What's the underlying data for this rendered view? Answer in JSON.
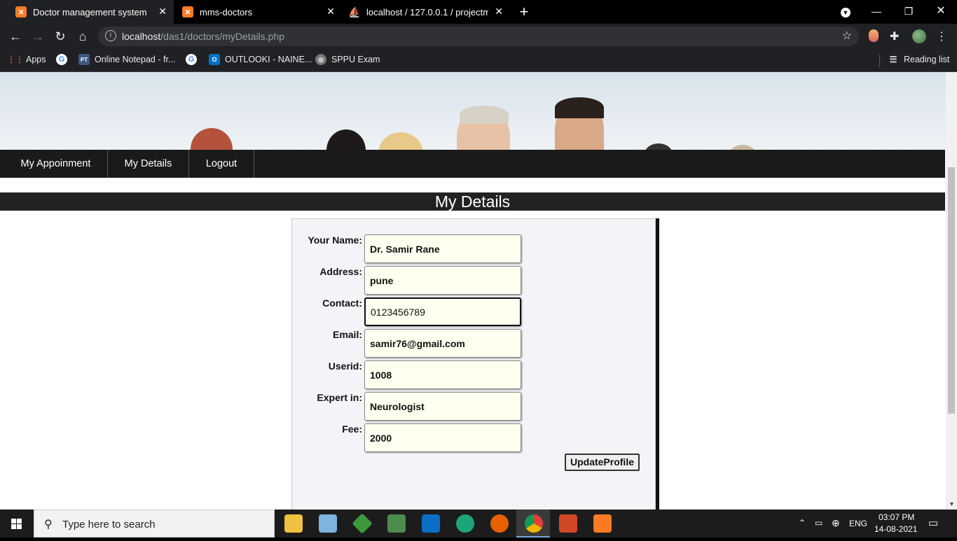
{
  "browser": {
    "tabs": [
      {
        "title": "Doctor management system"
      },
      {
        "title": "mms-doctors"
      },
      {
        "title": "localhost / 127.0.0.1 / projectmm"
      }
    ],
    "url_host": "localhost",
    "url_path": "/das1/doctors/myDetails.php",
    "bookmarks": [
      "Apps",
      "Online Notepad - fr...",
      "OUTLOOKI - NAINE...",
      "SPPU Exam"
    ],
    "reading_list": "Reading list"
  },
  "menu": {
    "items": [
      "My Appoinment",
      "My Details",
      "Logout"
    ]
  },
  "page": {
    "heading": "My Details"
  },
  "form": {
    "fields": [
      {
        "label": "Your Name:",
        "value": "Dr. Samir Rane"
      },
      {
        "label": "Address:",
        "value": "pune"
      },
      {
        "label": "Contact:",
        "value": "0123456789"
      },
      {
        "label": "Email:",
        "value": "samir76@gmail.com"
      },
      {
        "label": "Userid:",
        "value": "1008"
      },
      {
        "label": "Expert in:",
        "value": "Neurologist"
      },
      {
        "label": "Fee:",
        "value": "2000"
      }
    ],
    "submit_label": "UpdateProfile"
  },
  "taskbar": {
    "search_placeholder": "Type here to search",
    "language": "ENG",
    "time": "03:07 PM",
    "date": "14-08-2021"
  }
}
